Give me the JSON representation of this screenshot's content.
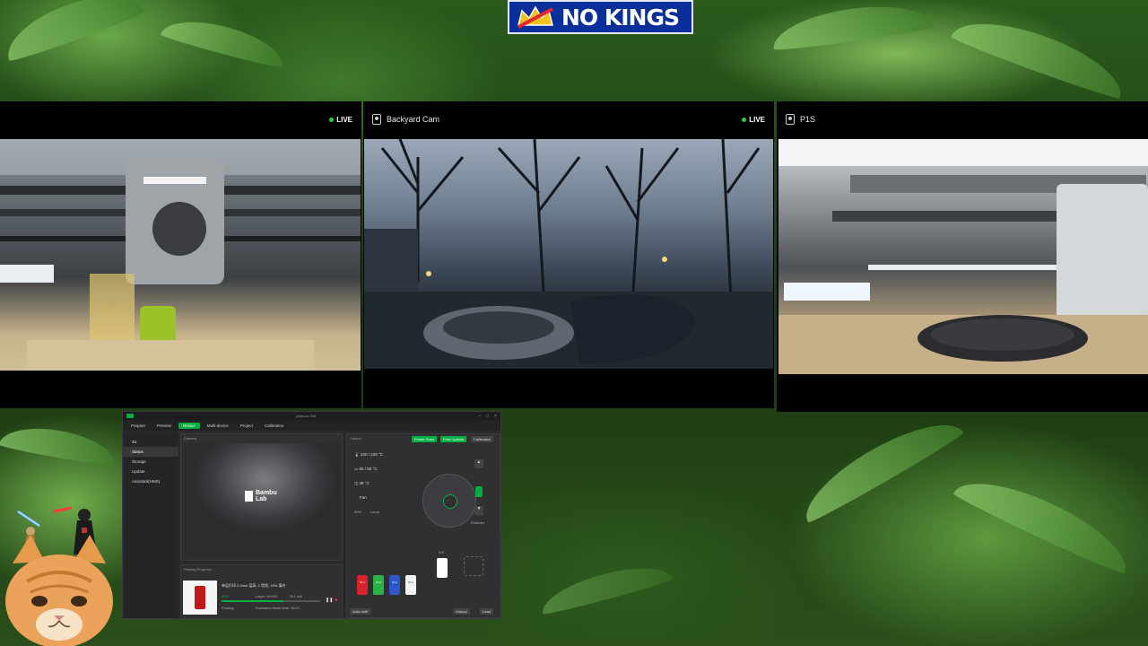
{
  "banner": {
    "text": "NO KINGS",
    "icon": "crown-icon",
    "bg_color": "#0b2f9a"
  },
  "cameras": [
    {
      "id": "cam1",
      "label": "",
      "live": "LIVE"
    },
    {
      "id": "cam2",
      "label": "Backyard Cam",
      "live": "LIVE"
    },
    {
      "id": "cam3",
      "label": "P1S",
      "live": ""
    }
  ],
  "app": {
    "title": "pepsi.m.3mf",
    "tabs": [
      "Prepare",
      "Preview",
      "Device",
      "Multi-device",
      "Project",
      "Calibration"
    ],
    "active_tab": "Device",
    "printer": "X1",
    "sidebar": [
      "Status",
      "Storage",
      "Update",
      "Assistant(HMS)"
    ],
    "active_sidebar": "Status",
    "camera_title": "Camera",
    "control_title": "Control",
    "control_buttons": {
      "printer_parts": "Printer Parts",
      "print_options": "Print Options",
      "calibration": "Calibration"
    },
    "temps": {
      "nozzle": "220 / 220 °C",
      "bed": "55 / 55 °C",
      "chamber": "35 °C"
    },
    "fan_label": "Fan",
    "lamp_label": "Lamp",
    "speed_label": "50%",
    "extruder_label": "Extruder",
    "ext_label": "Ext",
    "logo_text": [
      "Bambu",
      "Lab"
    ],
    "printing_progress_title": "Printing Progress",
    "job_name": "单层打印 0.2mm 层高, 2 墙线, 15% 填充",
    "layer": "Layer: 94/400",
    "remaining": "2h1 min",
    "progress_percent": "63%",
    "progress_value": 0.63,
    "status": "Printing",
    "estimated": "Estimated finish time: 18:21",
    "ams_slots": [
      {
        "label": "PLA",
        "color": "#d8232a"
      },
      {
        "label": "PLA",
        "color": "#2bb34a"
      },
      {
        "label": "PLA",
        "color": "#2f55c8"
      },
      {
        "label": "PLA",
        "color": "#f2f2f2"
      }
    ],
    "unload": "Unload",
    "load": "Load",
    "auto_refill": "Auto-refill"
  }
}
